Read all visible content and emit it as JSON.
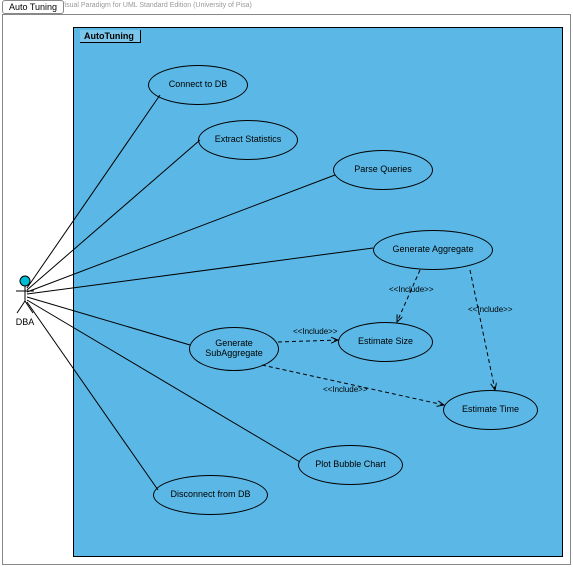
{
  "diagram": {
    "tab_title": "Auto Tuning",
    "watermark": "Visual Paradigm for UML Standard Edition (University of Pisa)",
    "system_name": "AutoTuning",
    "actor": {
      "name": "DBA"
    },
    "use_cases": {
      "connect": "Connect to DB",
      "extract": "Extract Statistics",
      "parse": "Parse Queries",
      "genagg": "Generate Aggregate",
      "gensub": "Generate SubAggregate",
      "estsize": "Estimate Size",
      "esttime": "Estimate Time",
      "plot": "Plot Bubble Chart",
      "disconnect": "Disconnect from DB"
    },
    "stereotype": "<<Include>>"
  },
  "chart_data": {
    "type": "uml-use-case",
    "title": "Auto Tuning",
    "system": "AutoTuning",
    "actors": [
      "DBA"
    ],
    "use_cases": [
      "Connect to DB",
      "Extract Statistics",
      "Parse Queries",
      "Generate Aggregate",
      "Generate SubAggregate",
      "Estimate Size",
      "Estimate Time",
      "Plot Bubble Chart",
      "Disconnect from DB"
    ],
    "associations": [
      {
        "actor": "DBA",
        "usecase": "Connect to DB"
      },
      {
        "actor": "DBA",
        "usecase": "Extract Statistics"
      },
      {
        "actor": "DBA",
        "usecase": "Parse Queries"
      },
      {
        "actor": "DBA",
        "usecase": "Generate Aggregate"
      },
      {
        "actor": "DBA",
        "usecase": "Generate SubAggregate"
      },
      {
        "actor": "DBA",
        "usecase": "Plot Bubble Chart"
      },
      {
        "actor": "DBA",
        "usecase": "Disconnect from DB"
      }
    ],
    "includes": [
      {
        "from": "Generate Aggregate",
        "to": "Estimate Size"
      },
      {
        "from": "Generate Aggregate",
        "to": "Estimate Time"
      },
      {
        "from": "Generate SubAggregate",
        "to": "Estimate Size"
      },
      {
        "from": "Generate SubAggregate",
        "to": "Estimate Time"
      }
    ]
  }
}
